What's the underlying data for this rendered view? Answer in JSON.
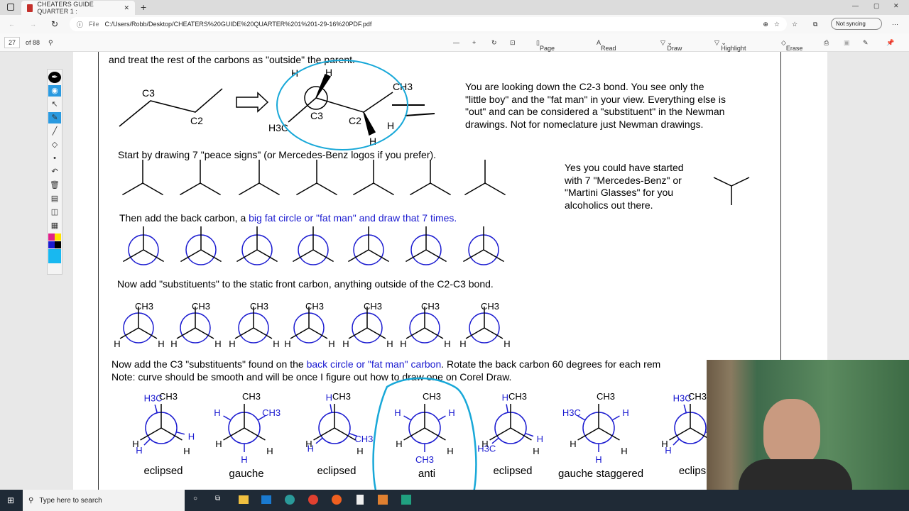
{
  "browser": {
    "tab_title": "CHEATERS GUIDE QUARTER 1 :",
    "url_prefix": "File",
    "url": "C:/Users/Robb/Desktop/CHEATERS%20GUIDE%20QUARTER%201%201-29-16%20PDF.pdf",
    "sync_label": "Not syncing"
  },
  "pdf_toolbar": {
    "page": "27",
    "of_pages": "of 88",
    "page_view": "Page view",
    "read_aloud": "Read aloud",
    "draw": "Draw",
    "highlight": "Highlight",
    "erase": "Erase"
  },
  "doc": {
    "line0": "and treat the rest of the carbons as \"outside\" the parent.",
    "chain_c3": "C3",
    "chain_c2": "C2",
    "wedge_labels": {
      "h1": "H",
      "h2": "H",
      "ch3": "CH3",
      "c3": "C3",
      "c2": "C2",
      "h3c": "H3C",
      "h4": "H",
      "h5": "H"
    },
    "explain": [
      "You are looking down the C2-3 bond. You see only the",
      "\"little boy\" and the \"fat man\" in your view. Everything else is",
      "\"out\" and can be considered a \"substituent\" in the Newman",
      "drawings. Not for nomeclature just Newman drawings."
    ],
    "step1": "Start by drawing 7 \"peace signs\" (or Mercedes-Benz logos if you prefer).",
    "aside": [
      "Yes you could have started",
      "with 7 \"Mercedes-Benz\" or",
      "\"Martini Glasses\" for you",
      "alcoholics out there."
    ],
    "step2_black": "Then add the back carbon, a ",
    "step2_blue": "big fat circle or \"fat man\" and draw that 7 times.",
    "step3": "Now add \"substituents\" to the static front carbon, anything outside of the C2-C3 bond.",
    "front_labels": {
      "top": "CH3",
      "left": "H",
      "right": "H"
    },
    "step4_a": "Now add the C3 \"substituents\" found on the ",
    "step4_blue": "back circle or \"fat man\" carbon",
    "step4_b": ". Rotate the back carbon 60 degrees for each rem",
    "note": "Note: curve should be smooth and will be once I figure out how to draw one on Corel Draw.",
    "conformations": [
      {
        "name": "eclipsed",
        "back": [
          "H3C",
          "H",
          "H"
        ]
      },
      {
        "name": "gauche",
        "back": [
          "H",
          "CH3",
          "H"
        ]
      },
      {
        "name": "eclipsed",
        "back": [
          "H",
          "H",
          "CH3"
        ]
      },
      {
        "name": "anti",
        "back": [
          "H",
          "H",
          "CH3"
        ]
      },
      {
        "name": "eclipsed",
        "back": [
          "H",
          "H3C",
          "H"
        ]
      },
      {
        "name": "gauche staggered",
        "back": [
          "H3C",
          "H",
          "H"
        ]
      },
      {
        "name": "eclips",
        "back": [
          "H3C",
          "H",
          "H"
        ]
      }
    ]
  },
  "taskbar": {
    "search_placeholder": "Type here to search"
  },
  "colors": {
    "blue_text": "#1a1ad0",
    "annotation": "#18a8d8"
  }
}
